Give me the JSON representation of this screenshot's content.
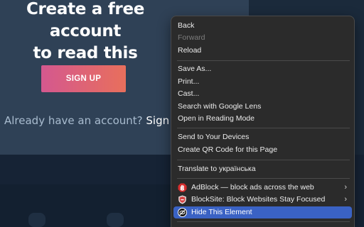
{
  "article": {
    "headline_line1": "Create a free account",
    "headline_line2": "to read this article.",
    "signup_label": "SIGN UP",
    "already_text": "Already have an account?",
    "signin_label": "Sign in",
    "period": "."
  },
  "context_menu": {
    "items": {
      "back": "Back",
      "forward": "Forward",
      "reload": "Reload",
      "save_as": "Save As...",
      "print": "Print...",
      "cast": "Cast...",
      "google_lens": "Search with Google Lens",
      "reading_mode": "Open in Reading Mode",
      "send_devices": "Send to Your Devices",
      "qr_code": "Create QR Code for this Page",
      "translate": "Translate to українська",
      "adblock": "AdBlock — block ads across the web",
      "blocksite": "BlockSite: Block Websites  Stay Focused",
      "hide_element": "Hide This Element"
    },
    "icons": {
      "adblock": "adblock-hand-icon",
      "blocksite": "blocksite-shield-icon",
      "hide_element": "eye-slash-icon"
    },
    "colors": {
      "menu_bg": "#2b2b2b",
      "highlight": "#3a62c4",
      "adblock_red": "#d62d2d"
    }
  },
  "colors": {
    "signup_gradient_start": "#d4588f",
    "signup_gradient_end": "#e86f5c",
    "modal_bg": "#2f4156"
  }
}
